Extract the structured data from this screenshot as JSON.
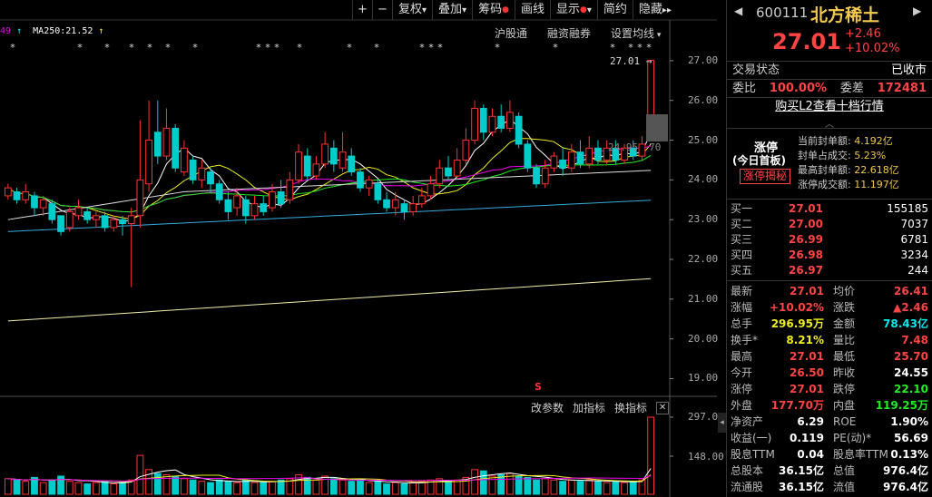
{
  "toolbar": {
    "plus": "+",
    "minus": "−",
    "items": [
      {
        "label": "复权",
        "arrow": "▾"
      },
      {
        "label": "叠加",
        "arrow": "▾"
      },
      {
        "label": "筹码",
        "dot": "●"
      },
      {
        "label": "画线"
      },
      {
        "label": "显示",
        "dot": "●",
        "arrow": "▾"
      },
      {
        "label": "简约"
      },
      {
        "label": "隐藏",
        "arrow": "▸▸"
      }
    ]
  },
  "legend": {
    "ma_left": "49",
    "ma250": "MA250:21.52"
  },
  "overlay_menu": {
    "a": "沪股通",
    "b": "融资融券",
    "c": "设置均线"
  },
  "price_label": "27.01",
  "mid_labels": {
    "a": "24.95",
    "b": "70"
  },
  "y_axis": [
    "27.00",
    "26.00",
    "25.00",
    "24.00",
    "23.00",
    "22.00",
    "21.00",
    "20.00",
    "19.00"
  ],
  "volume_axis": [
    "297.00",
    "148.00"
  ],
  "sub_menu": {
    "a": "改参数",
    "b": "加指标",
    "c": "换指标",
    "close": "✕"
  },
  "stock": {
    "code": "600111",
    "name": "北方稀土",
    "price": "27.01",
    "change": "+2.46",
    "change_pct": "+10.02%"
  },
  "status": {
    "label": "交易状态",
    "value": "已收市"
  },
  "weibi": {
    "l1": "委比",
    "v1": "100.00%",
    "l2": "委差",
    "v2": "172481"
  },
  "l2_link": "购买L2查看十档行情",
  "limit_up": {
    "title": "涨停",
    "sub": "(今日首板)",
    "btn": "涨停揭秘",
    "rows": [
      {
        "label": "当前封单额:",
        "value": "4.192亿"
      },
      {
        "label": "封单占成交:",
        "value": "5.23%"
      },
      {
        "label": "最高封单额:",
        "value": "22.618亿"
      },
      {
        "label": "涨停成交额:",
        "value": "11.197亿"
      }
    ]
  },
  "buy": [
    {
      "name": "买一",
      "price": "27.01",
      "vol": "155185"
    },
    {
      "name": "买二",
      "price": "27.00",
      "vol": "7037"
    },
    {
      "name": "买三",
      "price": "26.99",
      "vol": "6781"
    },
    {
      "name": "买四",
      "price": "26.98",
      "vol": "3234"
    },
    {
      "name": "买五",
      "price": "26.97",
      "vol": "244"
    }
  ],
  "stats": [
    {
      "l1": "最新",
      "v1": "27.01",
      "c1": "red",
      "l2": "均价",
      "v2": "26.41",
      "c2": "red"
    },
    {
      "l1": "涨幅",
      "v1": "+10.02%",
      "c1": "red",
      "l2": "涨跌",
      "v2": "▲2.46",
      "c2": "red"
    },
    {
      "l1": "总手",
      "v1": "296.95万",
      "c1": "yellow",
      "l2": "金额",
      "v2": "78.43亿",
      "c2": "cyan"
    },
    {
      "l1": "换手*",
      "v1": "8.21%",
      "c1": "yellow",
      "l2": "量比",
      "v2": "7.48",
      "c2": "red"
    },
    {
      "l1": "最高",
      "v1": "27.01",
      "c1": "red",
      "l2": "最低",
      "v2": "25.70",
      "c2": "red"
    },
    {
      "l1": "今开",
      "v1": "26.50",
      "c1": "red",
      "l2": "昨收",
      "v2": "24.55",
      "c2": "white"
    },
    {
      "l1": "涨停",
      "v1": "27.01",
      "c1": "red",
      "l2": "跌停",
      "v2": "22.10",
      "c2": "green"
    },
    {
      "l1": "外盘",
      "v1": "177.70万",
      "c1": "red",
      "l2": "内盘",
      "v2": "119.25万",
      "c2": "green"
    },
    {
      "l1": "净资产",
      "v1": "6.29",
      "c1": "white",
      "l2": "ROE",
      "v2": "1.90%",
      "c2": "white"
    },
    {
      "l1": "收益(一)",
      "v1": "0.119",
      "c1": "white",
      "l2": "PE(动)*",
      "v2": "56.69",
      "c2": "white"
    },
    {
      "l1": "股息TTM",
      "v1": "0.04",
      "c1": "white",
      "l2": "股息率TTM",
      "v2": "0.13%",
      "c2": "white"
    },
    {
      "l1": "总股本",
      "v1": "36.15亿",
      "c1": "white",
      "l2": "总值",
      "v2": "976.4亿",
      "c2": "white"
    },
    {
      "l1": "流通股",
      "v1": "36.15亿",
      "c1": "white",
      "l2": "流值",
      "v2": "976.4亿",
      "c2": "white"
    }
  ],
  "chart_data": {
    "type": "bar",
    "title": "",
    "ylim": [
      18.6,
      27.5
    ],
    "yticks": [
      27,
      26,
      25,
      24,
      23,
      22,
      21,
      20,
      19
    ],
    "candles": [
      {
        "o": 23.6,
        "c": 23.8,
        "h": 23.9,
        "l": 23.5
      },
      {
        "o": 23.7,
        "c": 23.5,
        "h": 23.8,
        "l": 23.4
      },
      {
        "o": 23.5,
        "c": 23.7,
        "h": 23.9,
        "l": 23.4
      },
      {
        "o": 23.6,
        "c": 23.3,
        "h": 23.7,
        "l": 23.1
      },
      {
        "o": 23.3,
        "c": 23.5,
        "h": 23.6,
        "l": 23.1
      },
      {
        "o": 23.4,
        "c": 23.0,
        "h": 23.5,
        "l": 22.9
      },
      {
        "o": 23.1,
        "c": 22.7,
        "h": 23.1,
        "l": 22.6
      },
      {
        "o": 22.8,
        "c": 23.2,
        "h": 23.3,
        "l": 22.7
      },
      {
        "o": 23.1,
        "c": 23.3,
        "h": 23.5,
        "l": 23.0
      },
      {
        "o": 23.2,
        "c": 23.0,
        "h": 23.3,
        "l": 22.9
      },
      {
        "o": 23.0,
        "c": 23.1,
        "h": 23.2,
        "l": 22.8
      },
      {
        "o": 23.1,
        "c": 22.8,
        "h": 23.2,
        "l": 22.7
      },
      {
        "o": 22.8,
        "c": 23.0,
        "h": 23.1,
        "l": 22.7
      },
      {
        "o": 23.0,
        "c": 22.9,
        "h": 23.1,
        "l": 22.6
      },
      {
        "o": 22.9,
        "c": 23.1,
        "h": 23.3,
        "l": 21.3
      },
      {
        "o": 23.1,
        "c": 24.0,
        "h": 25.5,
        "l": 22.8
      },
      {
        "o": 23.9,
        "c": 25.0,
        "h": 26.0,
        "l": 23.7
      },
      {
        "o": 25.2,
        "c": 24.6,
        "h": 26.0,
        "l": 24.4
      },
      {
        "o": 24.6,
        "c": 25.3,
        "h": 25.8,
        "l": 24.5
      },
      {
        "o": 25.3,
        "c": 24.3,
        "h": 25.4,
        "l": 24.2
      },
      {
        "o": 24.2,
        "c": 24.8,
        "h": 25.0,
        "l": 24.1
      },
      {
        "o": 24.5,
        "c": 24.0,
        "h": 24.6,
        "l": 23.9
      },
      {
        "o": 24.0,
        "c": 24.3,
        "h": 24.5,
        "l": 23.8
      },
      {
        "o": 24.2,
        "c": 23.9,
        "h": 24.3,
        "l": 23.7
      },
      {
        "o": 23.9,
        "c": 23.5,
        "h": 24.0,
        "l": 23.4
      },
      {
        "o": 23.5,
        "c": 23.2,
        "h": 23.7,
        "l": 23.0
      },
      {
        "o": 23.3,
        "c": 23.6,
        "h": 23.8,
        "l": 23.1
      },
      {
        "o": 23.5,
        "c": 23.1,
        "h": 23.6,
        "l": 22.9
      },
      {
        "o": 23.1,
        "c": 23.4,
        "h": 23.6,
        "l": 23.0
      },
      {
        "o": 23.4,
        "c": 23.2,
        "h": 23.6,
        "l": 23.1
      },
      {
        "o": 23.3,
        "c": 23.7,
        "h": 23.9,
        "l": 23.2
      },
      {
        "o": 23.7,
        "c": 23.4,
        "h": 24.0,
        "l": 23.3
      },
      {
        "o": 23.5,
        "c": 24.0,
        "h": 24.2,
        "l": 23.4
      },
      {
        "o": 24.0,
        "c": 24.7,
        "h": 24.9,
        "l": 23.9
      },
      {
        "o": 24.6,
        "c": 24.1,
        "h": 24.8,
        "l": 24.0
      },
      {
        "o": 24.1,
        "c": 24.4,
        "h": 24.6,
        "l": 24.0
      },
      {
        "o": 24.4,
        "c": 24.9,
        "h": 25.2,
        "l": 24.3
      },
      {
        "o": 24.8,
        "c": 24.4,
        "h": 25.0,
        "l": 24.2
      },
      {
        "o": 24.3,
        "c": 24.7,
        "h": 25.2,
        "l": 24.2
      },
      {
        "o": 24.6,
        "c": 24.2,
        "h": 24.8,
        "l": 24.1
      },
      {
        "o": 24.2,
        "c": 23.8,
        "h": 24.3,
        "l": 23.7
      },
      {
        "o": 23.8,
        "c": 24.0,
        "h": 24.1,
        "l": 23.6
      },
      {
        "o": 23.9,
        "c": 23.5,
        "h": 24.0,
        "l": 23.4
      },
      {
        "o": 23.5,
        "c": 23.3,
        "h": 23.7,
        "l": 23.2
      },
      {
        "o": 23.3,
        "c": 23.5,
        "h": 23.7,
        "l": 23.1
      },
      {
        "o": 23.4,
        "c": 23.2,
        "h": 23.5,
        "l": 23.0
      },
      {
        "o": 23.2,
        "c": 23.4,
        "h": 23.6,
        "l": 23.1
      },
      {
        "o": 23.4,
        "c": 23.6,
        "h": 23.8,
        "l": 23.3
      },
      {
        "o": 23.6,
        "c": 23.9,
        "h": 24.1,
        "l": 23.5
      },
      {
        "o": 23.9,
        "c": 24.3,
        "h": 24.5,
        "l": 23.8
      },
      {
        "o": 24.3,
        "c": 24.1,
        "h": 24.6,
        "l": 24.0
      },
      {
        "o": 24.1,
        "c": 24.5,
        "h": 24.8,
        "l": 24.0
      },
      {
        "o": 24.5,
        "c": 25.0,
        "h": 25.3,
        "l": 24.4
      },
      {
        "o": 25.0,
        "c": 25.8,
        "h": 26.0,
        "l": 24.9
      },
      {
        "o": 25.8,
        "c": 25.2,
        "h": 25.9,
        "l": 25.0
      },
      {
        "o": 25.2,
        "c": 25.6,
        "h": 25.8,
        "l": 25.1
      },
      {
        "o": 25.6,
        "c": 25.3,
        "h": 25.9,
        "l": 25.2
      },
      {
        "o": 25.3,
        "c": 25.7,
        "h": 26.0,
        "l": 25.2
      },
      {
        "o": 25.6,
        "c": 24.9,
        "h": 25.7,
        "l": 24.8
      },
      {
        "o": 24.9,
        "c": 24.3,
        "h": 25.0,
        "l": 24.2
      },
      {
        "o": 24.3,
        "c": 23.9,
        "h": 24.4,
        "l": 23.8
      },
      {
        "o": 23.9,
        "c": 24.3,
        "h": 24.5,
        "l": 23.8
      },
      {
        "o": 24.3,
        "c": 24.6,
        "h": 24.7,
        "l": 24.2
      },
      {
        "o": 24.5,
        "c": 24.3,
        "h": 24.8,
        "l": 24.1
      },
      {
        "o": 24.3,
        "c": 24.7,
        "h": 24.9,
        "l": 24.2
      },
      {
        "o": 24.7,
        "c": 24.4,
        "h": 25.0,
        "l": 24.3
      },
      {
        "o": 24.4,
        "c": 24.8,
        "h": 25.1,
        "l": 24.3
      },
      {
        "o": 24.8,
        "c": 24.5,
        "h": 25.0,
        "l": 24.4
      },
      {
        "o": 24.5,
        "c": 24.8,
        "h": 25.0,
        "l": 24.4
      },
      {
        "o": 24.8,
        "c": 24.5,
        "h": 25.0,
        "l": 24.4
      },
      {
        "o": 24.5,
        "c": 24.8,
        "h": 24.9,
        "l": 24.4
      },
      {
        "o": 24.8,
        "c": 24.6,
        "h": 25.0,
        "l": 24.5
      },
      {
        "o": 24.6,
        "c": 24.9,
        "h": 25.1,
        "l": 24.5
      },
      {
        "o": 25.0,
        "c": 27.01,
        "h": 27.01,
        "l": 25.7
      }
    ],
    "volumes": [
      60,
      55,
      50,
      65,
      45,
      55,
      70,
      50,
      45,
      40,
      45,
      50,
      40,
      45,
      55,
      150,
      95,
      80,
      75,
      70,
      60,
      55,
      50,
      45,
      55,
      50,
      45,
      55,
      45,
      45,
      50,
      55,
      60,
      75,
      65,
      55,
      70,
      60,
      55,
      50,
      55,
      45,
      50,
      40,
      45,
      40,
      45,
      50,
      55,
      60,
      50,
      55,
      65,
      95,
      90,
      70,
      75,
      80,
      70,
      65,
      55,
      60,
      55,
      50,
      55,
      50,
      55,
      50,
      45,
      50,
      45,
      50,
      55,
      297
    ]
  }
}
